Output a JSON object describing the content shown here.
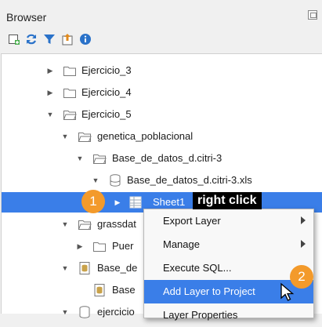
{
  "panel": {
    "title": "Browser"
  },
  "toolbar": {
    "icons": [
      "add-layer-icon",
      "refresh-icon",
      "filter-icon",
      "collapse-all-icon",
      "info-icon"
    ]
  },
  "tree": {
    "items": [
      {
        "label": "Ejercicio_3",
        "icon": "folder-icon",
        "expand": "collapsed"
      },
      {
        "label": "Ejercicio_4",
        "icon": "folder-icon",
        "expand": "collapsed"
      },
      {
        "label": "Ejercicio_5",
        "icon": "folder-open-icon",
        "expand": "expanded"
      },
      {
        "label": "genetica_poblacional",
        "icon": "folder-open-icon",
        "expand": "expanded"
      },
      {
        "label": "Base_de_datos_d.citri-3",
        "icon": "folder-open-icon",
        "expand": "expanded"
      },
      {
        "label": "Base_de_datos_d.citri-3.xls",
        "icon": "database-icon",
        "expand": "expanded"
      },
      {
        "label": "Sheet1",
        "icon": "table-icon",
        "expand": "collapsed",
        "selected": true
      },
      {
        "label": "grassdat",
        "icon": "folder-open-icon",
        "expand": "expanded"
      },
      {
        "label": "Puer",
        "icon": "folder-icon",
        "expand": "collapsed"
      },
      {
        "label": "Base_de",
        "icon": "db-file-icon",
        "expand": "expanded"
      },
      {
        "label": "Base",
        "icon": "db-file-icon",
        "expand": "none"
      },
      {
        "label": "ejercicio",
        "icon": "database-icon",
        "expand": "expanded"
      }
    ]
  },
  "context_menu": {
    "items": [
      {
        "label": "Export Layer",
        "submenu": true
      },
      {
        "label": "Manage",
        "submenu": true
      },
      {
        "label": "Execute SQL...",
        "submenu": false
      },
      {
        "label": "Add Layer to Project",
        "submenu": false,
        "highlighted": true
      },
      {
        "label": "Layer Properties",
        "submenu": false
      }
    ]
  },
  "annotations": {
    "step1": "1",
    "step2": "2",
    "callout": "right click"
  },
  "colors": {
    "selection": "#3a7ee8",
    "badge": "#f39a2b",
    "folder": "#8a8a8a"
  }
}
